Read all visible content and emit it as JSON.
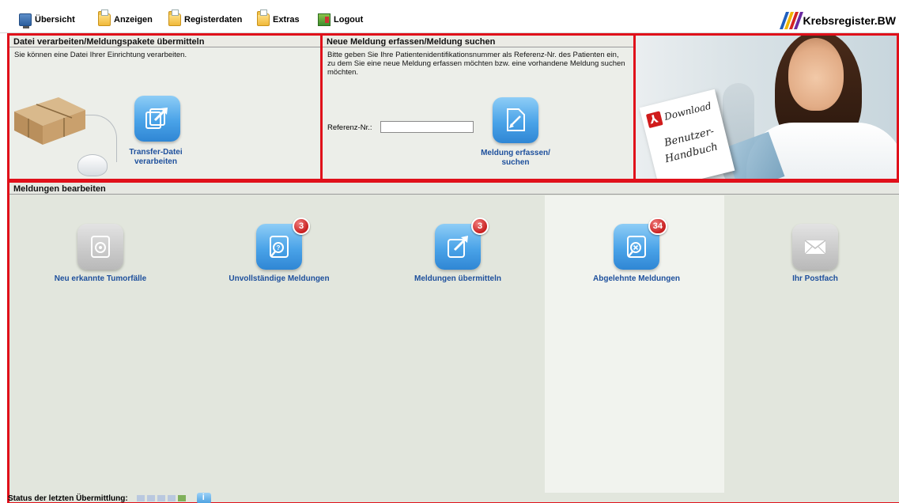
{
  "menu": {
    "items": [
      {
        "label": "Übersicht",
        "icon": "monitor-icon"
      },
      {
        "label": "Anzeigen",
        "icon": "folder-icon"
      },
      {
        "label": "Registerdaten",
        "icon": "folder-icon"
      },
      {
        "label": "Extras",
        "icon": "folder-icon"
      },
      {
        "label": "Logout",
        "icon": "logout-icon"
      }
    ],
    "brand": "Krebsregister.BW"
  },
  "panel_transfer": {
    "title": "Datei verarbeiten/Meldungspakete übermitteln",
    "description": "Sie können eine Datei Ihrer Einrichtung verarbeiten.",
    "action_label_1": "Transfer-Datei",
    "action_label_2": "verarbeiten"
  },
  "panel_new": {
    "title": "Neue Meldung erfassen/Meldung suchen",
    "description": "Bitte geben Sie Ihre Patientenidentifikationsnummer als Referenz-Nr. des Patienten ein, zu dem Sie eine neue Meldung erfassen möchten bzw. eine vorhandene Meldung suchen möchten.",
    "ref_label": "Referenz-Nr.:",
    "ref_value": "",
    "action_label_1": "Meldung erfassen/",
    "action_label_2": "suchen"
  },
  "panel_download": {
    "line1": "Download",
    "line2": "Benutzer-",
    "line3": "Handbuch"
  },
  "meldungen": {
    "title": "Meldungen bearbeiten",
    "actions": [
      {
        "label": "Neu erkannte Tumorfälle",
        "badge": "",
        "icon": "new-case-icon",
        "enabled": false
      },
      {
        "label": "Unvollständige Meldungen",
        "badge": "3",
        "icon": "incomplete-report-icon",
        "enabled": true
      },
      {
        "label": "Meldungen übermitteln",
        "badge": "3",
        "icon": "submit-report-icon",
        "enabled": true
      },
      {
        "label": "Abgelehnte Meldungen",
        "badge": "34",
        "icon": "rejected-report-icon",
        "enabled": true
      },
      {
        "label": "Ihr Postfach",
        "badge": "",
        "icon": "mailbox-icon",
        "enabled": false
      }
    ]
  },
  "status": {
    "label": "Status der letzten Übermittlung:",
    "blocks_total": 5,
    "blocks_green": 1
  },
  "colors": {
    "frame_red": "#e0101a",
    "link_blue": "#1d4f9c",
    "badge_red": "#c82020",
    "panel_bg": "#eceee9"
  }
}
